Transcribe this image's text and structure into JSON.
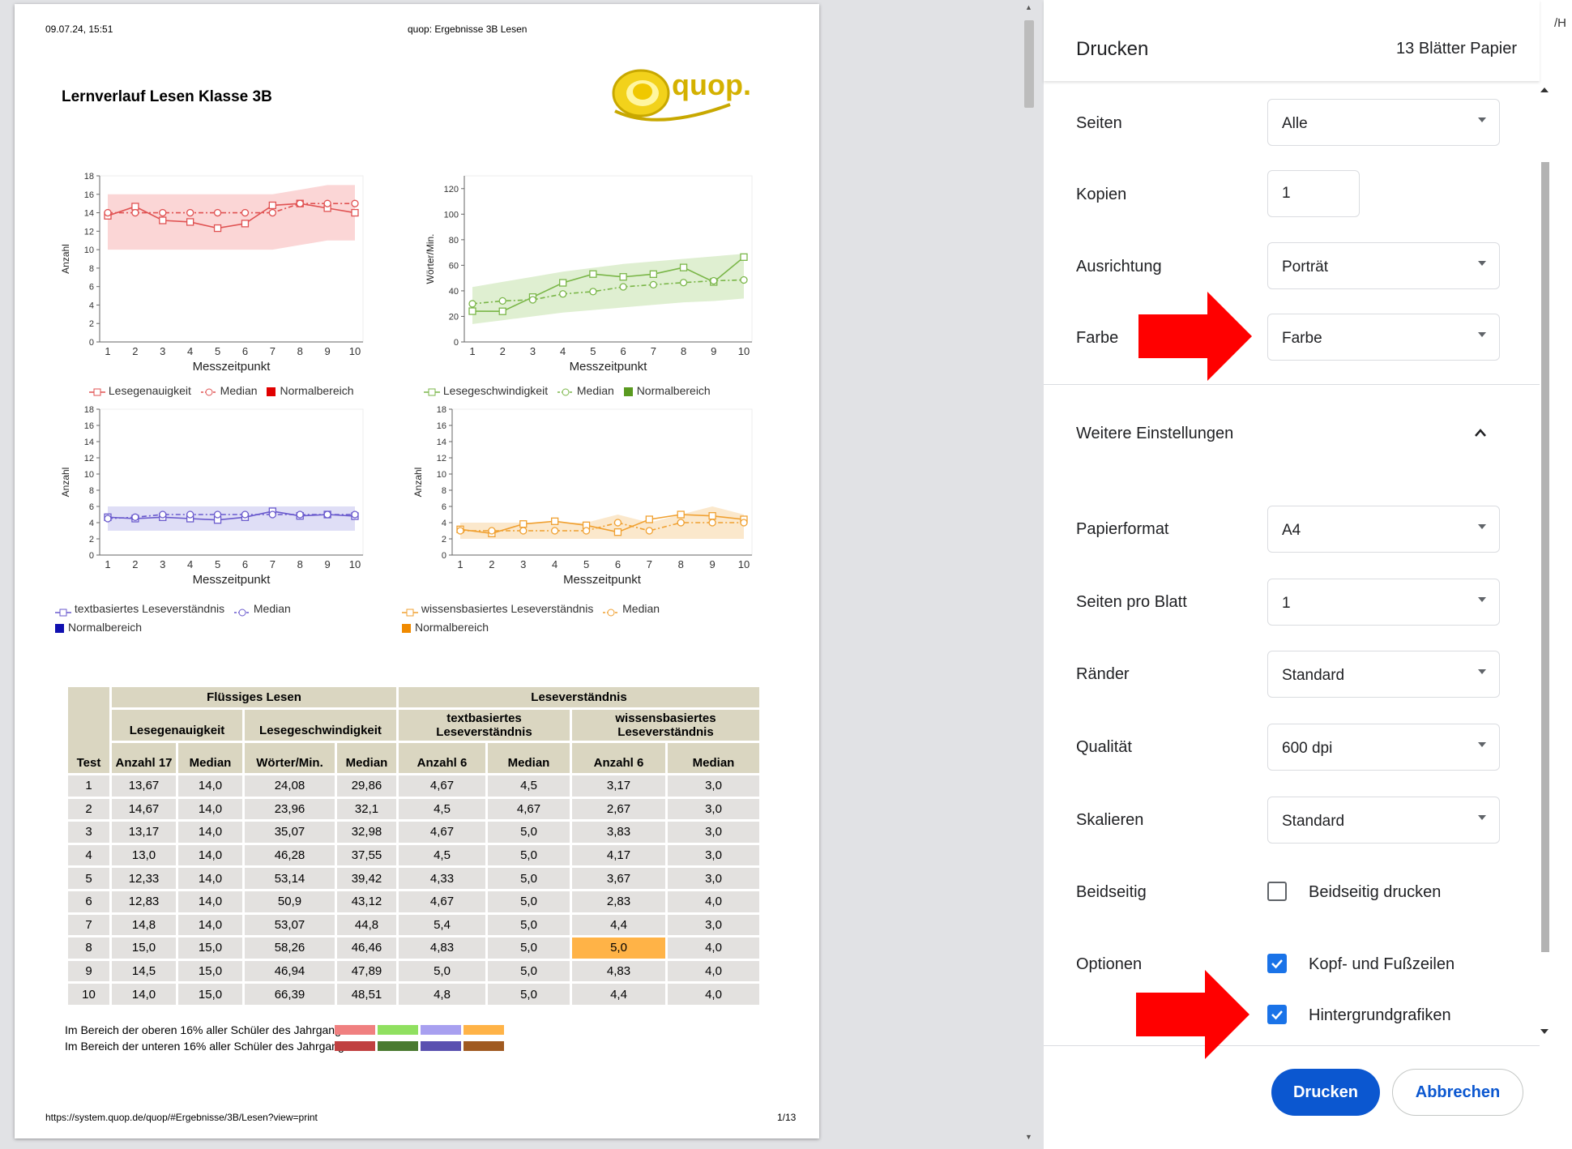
{
  "page_header": {
    "date": "09.07.24, 15:51",
    "title": "quop: Ergebnisse 3B Lesen"
  },
  "report_title": "Lernverlauf Lesen Klasse 3B",
  "logo_text": "quop.",
  "chart_data": [
    {
      "type": "line",
      "id": "lesegenauigkeit",
      "color": "#e05252",
      "band_color": "#fbd2d2",
      "ylabel": "Anzahl",
      "xlabel": "Messzeitpunkt",
      "ylim": [
        0,
        18
      ],
      "yticks": [
        0,
        2,
        4,
        6,
        8,
        10,
        12,
        14,
        16,
        18
      ],
      "x": [
        1,
        2,
        3,
        4,
        5,
        6,
        7,
        8,
        9,
        10
      ],
      "series": [
        {
          "name": "Lesegenauigkeit",
          "values": [
            13.67,
            14.67,
            13.17,
            13.0,
            12.33,
            12.83,
            14.8,
            15.0,
            14.5,
            14.0
          ]
        },
        {
          "name": "Median",
          "values": [
            14.0,
            14.0,
            14.0,
            14.0,
            14.0,
            14.0,
            14.0,
            15.0,
            15.0,
            15.0
          ],
          "dashed": true
        }
      ],
      "band": {
        "name": "Normalbereich",
        "lower": [
          10,
          10,
          10,
          10,
          10,
          10,
          10,
          10.5,
          11,
          11
        ],
        "upper": [
          16,
          16,
          16,
          16,
          16,
          16,
          16,
          16.5,
          17,
          17
        ]
      }
    },
    {
      "type": "line",
      "id": "lesegeschwindigkeit",
      "color": "#7ab648",
      "band_color": "#dcedcc",
      "ylabel": "Wörter/Min.",
      "xlabel": "Messzeitpunkt",
      "ylim": [
        0,
        130
      ],
      "yticks": [
        0,
        20,
        40,
        60,
        80,
        100,
        120
      ],
      "x": [
        1,
        2,
        3,
        4,
        5,
        6,
        7,
        8,
        9,
        10
      ],
      "series": [
        {
          "name": "Lesegeschwindigkeit",
          "values": [
            24.08,
            23.96,
            35.07,
            46.28,
            53.14,
            50.9,
            53.07,
            58.26,
            46.94,
            66.39
          ]
        },
        {
          "name": "Median",
          "values": [
            29.86,
            32.1,
            32.98,
            37.55,
            39.42,
            43.12,
            44.8,
            46.46,
            47.89,
            48.51
          ],
          "dashed": true
        }
      ],
      "band": {
        "name": "Normalbereich",
        "lower": [
          14,
          17,
          20,
          23,
          25,
          27,
          29,
          31,
          32,
          34
        ],
        "upper": [
          43,
          47,
          51,
          55,
          58,
          61,
          63,
          65,
          67,
          69
        ]
      }
    },
    {
      "type": "line",
      "id": "textbasiert",
      "color": "#6a5acd",
      "band_color": "#dcdaf5",
      "ylabel": "Anzahl",
      "xlabel": "Messzeitpunkt",
      "ylim": [
        0,
        18
      ],
      "yticks": [
        0,
        2,
        4,
        6,
        8,
        10,
        12,
        14,
        16,
        18
      ],
      "x": [
        1,
        2,
        3,
        4,
        5,
        6,
        7,
        8,
        9,
        10
      ],
      "series": [
        {
          "name": "textbasiertes Leseverständnis",
          "values": [
            4.67,
            4.5,
            4.67,
            4.5,
            4.33,
            4.67,
            5.4,
            4.83,
            5.0,
            4.8
          ]
        },
        {
          "name": "Median",
          "values": [
            4.5,
            4.67,
            5.0,
            5.0,
            5.0,
            5.0,
            5.0,
            5.0,
            5.0,
            5.0
          ],
          "dashed": true
        }
      ],
      "band": {
        "name": "Normalbereich",
        "lower": [
          3,
          3,
          3,
          3,
          3,
          3,
          3,
          3,
          3,
          3
        ],
        "upper": [
          6,
          6,
          6,
          6,
          6,
          6,
          6,
          6,
          6,
          6
        ]
      }
    },
    {
      "type": "line",
      "id": "wissensbasiert",
      "color": "#f0a030",
      "band_color": "#fbe6c6",
      "ylabel": "Anzahl",
      "xlabel": "Messzeitpunkt",
      "ylim": [
        0,
        18
      ],
      "yticks": [
        0,
        2,
        4,
        6,
        8,
        10,
        12,
        14,
        16,
        18
      ],
      "x": [
        1,
        2,
        3,
        4,
        5,
        6,
        7,
        8,
        9,
        10
      ],
      "series": [
        {
          "name": "wissensbasiertes Leseverständnis",
          "values": [
            3.17,
            2.67,
            3.83,
            4.17,
            3.67,
            2.83,
            4.4,
            5.0,
            4.83,
            4.4
          ]
        },
        {
          "name": "Median",
          "values": [
            3.0,
            3.0,
            3.0,
            3.0,
            3.0,
            4.0,
            3.0,
            4.0,
            4.0,
            4.0
          ],
          "dashed": true
        }
      ],
      "band": {
        "name": "Normalbereich",
        "lower": [
          2,
          2,
          2,
          2,
          2,
          2,
          2,
          2,
          2,
          2
        ],
        "upper": [
          4,
          4,
          4,
          4,
          4,
          5,
          4,
          5,
          6,
          5
        ]
      }
    }
  ],
  "legends": {
    "c1": [
      "Lesegenauigkeit",
      "Median",
      "Normalbereich"
    ],
    "c2": [
      "Lesegeschwindigkeit",
      "Median",
      "Normalbereich"
    ],
    "c3": [
      "textbasiertes Leseverständnis",
      "Median",
      "Normalbereich"
    ],
    "c4": [
      "wissensbasiertes Leseverständnis",
      "Median",
      "Normalbereich"
    ]
  },
  "table": {
    "group1": "Flüssiges Lesen",
    "group2": "Leseverständnis",
    "sub": [
      "Lesegenauigkeit",
      "Lesegeschwindigkeit",
      "textbasiertes Leseverständnis",
      "wissensbasiertes Leseverständnis"
    ],
    "test_header": "Test",
    "cols": [
      "Anzahl 17",
      "Median",
      "Wörter/Min.",
      "Median",
      "Anzahl 6",
      "Median",
      "Anzahl 6",
      "Median"
    ],
    "rows": [
      [
        "1",
        "13,67",
        "14,0",
        "24,08",
        "29,86",
        "4,67",
        "4,5",
        "3,17",
        "3,0"
      ],
      [
        "2",
        "14,67",
        "14,0",
        "23,96",
        "32,1",
        "4,5",
        "4,67",
        "2,67",
        "3,0"
      ],
      [
        "3",
        "13,17",
        "14,0",
        "35,07",
        "32,98",
        "4,67",
        "5,0",
        "3,83",
        "3,0"
      ],
      [
        "4",
        "13,0",
        "14,0",
        "46,28",
        "37,55",
        "4,5",
        "5,0",
        "4,17",
        "3,0"
      ],
      [
        "5",
        "12,33",
        "14,0",
        "53,14",
        "39,42",
        "4,33",
        "5,0",
        "3,67",
        "3,0"
      ],
      [
        "6",
        "12,83",
        "14,0",
        "50,9",
        "43,12",
        "4,67",
        "5,0",
        "2,83",
        "4,0"
      ],
      [
        "7",
        "14,8",
        "14,0",
        "53,07",
        "44,8",
        "5,4",
        "5,0",
        "4,4",
        "3,0"
      ],
      [
        "8",
        "15,0",
        "15,0",
        "58,26",
        "46,46",
        "4,83",
        "5,0",
        "5,0",
        "4,0"
      ],
      [
        "9",
        "14,5",
        "15,0",
        "46,94",
        "47,89",
        "5,0",
        "5,0",
        "4,83",
        "4,0"
      ],
      [
        "10",
        "14,0",
        "15,0",
        "66,39",
        "48,51",
        "4,8",
        "5,0",
        "4,4",
        "4,0"
      ]
    ],
    "upper_note": "Im Bereich der oberen 16% aller Schüler des Jahrgangs:",
    "lower_note": "Im Bereich der unteren 16% aller Schüler des Jahrgangs:",
    "upper_colors": [
      "#f08080",
      "#90e060",
      "#a8a0f0",
      "#ffb347"
    ],
    "lower_colors": [
      "#c04040",
      "#4a7a30",
      "#5a50b0",
      "#a05a20"
    ]
  },
  "page_footer": {
    "url": "https://system.quop.de/quop/#Ergebnisse/3B/Lesen?view=print",
    "page": "1/13"
  },
  "dialog": {
    "title": "Drucken",
    "sheets": "13 Blätter Papier",
    "pages_label": "Seiten",
    "pages_value": "Alle",
    "copies_label": "Kopien",
    "copies_value": "1",
    "orientation_label": "Ausrichtung",
    "orientation_value": "Porträt",
    "color_label": "Farbe",
    "color_value": "Farbe",
    "more_settings": "Weitere Einstellungen",
    "paper_label": "Papierformat",
    "paper_value": "A4",
    "pps_label": "Seiten pro Blatt",
    "pps_value": "1",
    "margins_label": "Ränder",
    "margins_value": "Standard",
    "quality_label": "Qualität",
    "quality_value": "600 dpi",
    "scale_label": "Skalieren",
    "scale_value": "Standard",
    "duplex_label": "Beidseitig",
    "duplex_option": "Beidseitig drucken",
    "duplex_checked": false,
    "options_label": "Optionen",
    "headers_option": "Kopf- und Fußzeilen",
    "headers_checked": true,
    "bg_option": "Hintergrundgrafiken",
    "bg_checked": true,
    "print_button": "Drucken",
    "cancel_button": "Abbrechen"
  },
  "corner_text": "/H",
  "arrow_color": "#ff0000"
}
